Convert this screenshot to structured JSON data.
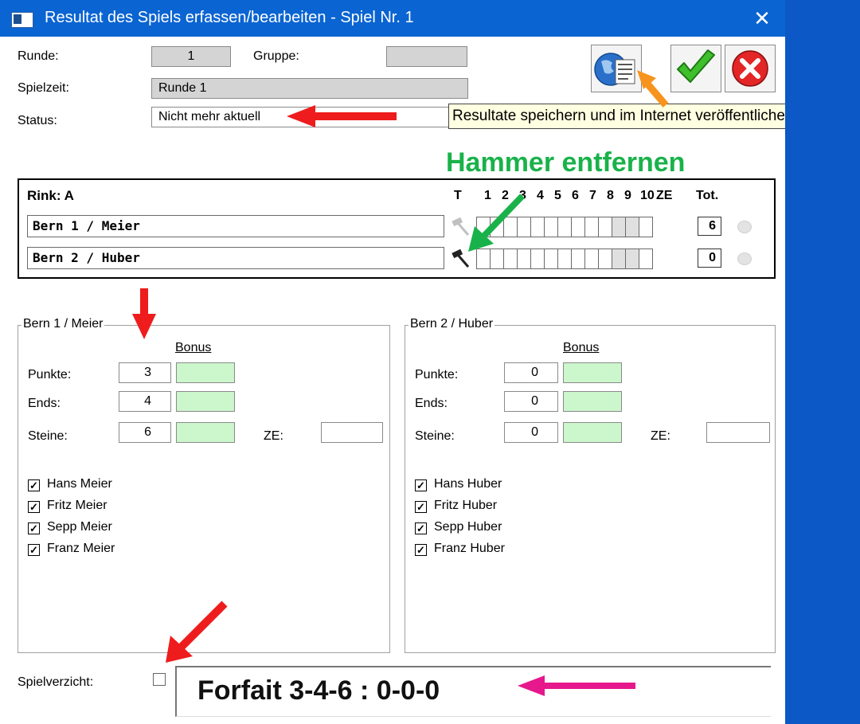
{
  "window": {
    "title": "Resultat des Spiels erfassen/bearbeiten - Spiel Nr. 1",
    "close_glyph": "✕"
  },
  "header": {
    "runde_label": "Runde:",
    "runde_value": "1",
    "gruppe_label": "Gruppe:",
    "gruppe_value": "",
    "spielzeit_label": "Spielzeit:",
    "spielzeit_value": "Runde 1",
    "status_label": "Status:",
    "status_value": "Nicht mehr aktuell"
  },
  "buttons": {
    "publish_icon": "globe-document-icon",
    "ok_icon": "checkmark-icon",
    "cancel_icon": "red-x-icon"
  },
  "tooltip": "Resultate speichern und im Internet veröffentlichen",
  "annotation": {
    "hammer_text": "Hammer entfernen"
  },
  "rink": {
    "title": "Rink: A",
    "header": {
      "t": "T",
      "ends": [
        "1",
        "2",
        "3",
        "4",
        "5",
        "6",
        "7",
        "8",
        "9",
        "10",
        "ZE"
      ],
      "total": "Tot."
    },
    "teams": [
      {
        "name": "Bern 1 / Meier",
        "total": "6",
        "hammer": false
      },
      {
        "name": "Bern 2 / Huber",
        "total": "0",
        "hammer": true
      }
    ]
  },
  "teams": [
    {
      "legend": "Bern 1 / Meier",
      "bonus_label": "Bonus",
      "punkte_label": "Punkte:",
      "punkte": "3",
      "ends_label": "Ends:",
      "ends": "4",
      "steine_label": "Steine:",
      "steine": "6",
      "ze_label": "ZE:",
      "ze": "",
      "players": [
        "Hans Meier",
        "Fritz Meier",
        "Sepp Meier",
        "Franz Meier"
      ]
    },
    {
      "legend": "Bern 2 / Huber",
      "bonus_label": "Bonus",
      "punkte_label": "Punkte:",
      "punkte": "0",
      "ends_label": "Ends:",
      "ends": "0",
      "steine_label": "Steine:",
      "steine": "0",
      "ze_label": "ZE:",
      "ze": "",
      "players": [
        "Hans Huber",
        "Fritz Huber",
        "Sepp Huber",
        "Franz Huber"
      ]
    }
  ],
  "spielverzicht": {
    "label": "Spielverzicht:",
    "checked": false
  },
  "forfait": {
    "text": "Forfait 3-4-6 : 0-0-0"
  },
  "colors": {
    "accent_blue": "#0a64d2",
    "arrow_red": "#ee1c1c",
    "arrow_green": "#19b24a",
    "arrow_orange": "#f7941d",
    "arrow_magenta": "#e6188c",
    "bonus_green": "#ccf6cc"
  }
}
